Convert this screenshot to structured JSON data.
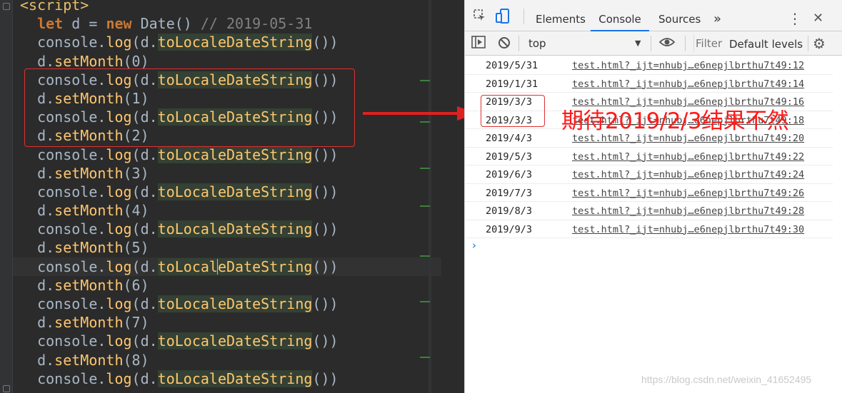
{
  "editor": {
    "lines": [
      [
        {
          "t": "<script>",
          "c": "tag"
        }
      ],
      [
        {
          "t": "  "
        },
        {
          "t": "let",
          "c": "kw"
        },
        {
          "t": " d = "
        },
        {
          "t": "new",
          "c": "kw"
        },
        {
          "t": " Date() "
        },
        {
          "t": "// 2019-05-31",
          "c": "cmt"
        }
      ],
      [
        {
          "t": "  console."
        },
        {
          "t": "log",
          "c": "fn"
        },
        {
          "t": "(d."
        },
        {
          "t": "toLocaleDateString",
          "c": "fn hl"
        },
        {
          "t": "())"
        }
      ],
      [
        {
          "t": "  d."
        },
        {
          "t": "setMonth",
          "c": "fn"
        },
        {
          "t": "(0)"
        }
      ],
      [
        {
          "t": "  console."
        },
        {
          "t": "log",
          "c": "fn"
        },
        {
          "t": "(d."
        },
        {
          "t": "toLocaleDateString",
          "c": "fn hl"
        },
        {
          "t": "())"
        }
      ],
      [
        {
          "t": "  d."
        },
        {
          "t": "setMonth",
          "c": "fn"
        },
        {
          "t": "(1)"
        }
      ],
      [
        {
          "t": "  console."
        },
        {
          "t": "log",
          "c": "fn"
        },
        {
          "t": "(d."
        },
        {
          "t": "toLocaleDateString",
          "c": "fn hl"
        },
        {
          "t": "())"
        }
      ],
      [
        {
          "t": "  d."
        },
        {
          "t": "setMonth",
          "c": "fn"
        },
        {
          "t": "(2)"
        }
      ],
      [
        {
          "t": "  console."
        },
        {
          "t": "log",
          "c": "fn"
        },
        {
          "t": "(d."
        },
        {
          "t": "toLocaleDateString",
          "c": "fn hl"
        },
        {
          "t": "())"
        }
      ],
      [
        {
          "t": "  d."
        },
        {
          "t": "setMonth",
          "c": "fn"
        },
        {
          "t": "(3)"
        }
      ],
      [
        {
          "t": "  console."
        },
        {
          "t": "log",
          "c": "fn"
        },
        {
          "t": "(d."
        },
        {
          "t": "toLocaleDateString",
          "c": "fn hl"
        },
        {
          "t": "())"
        }
      ],
      [
        {
          "t": "  d."
        },
        {
          "t": "setMonth",
          "c": "fn"
        },
        {
          "t": "(4)"
        }
      ],
      [
        {
          "t": "  console."
        },
        {
          "t": "log",
          "c": "fn"
        },
        {
          "t": "(d."
        },
        {
          "t": "toLocaleDateString",
          "c": "fn hl"
        },
        {
          "t": "())"
        }
      ],
      [
        {
          "t": "  d."
        },
        {
          "t": "setMonth",
          "c": "fn"
        },
        {
          "t": "(5)"
        }
      ],
      [
        {
          "t": "  console."
        },
        {
          "t": "log",
          "c": "fn"
        },
        {
          "t": "(d."
        },
        {
          "t": "toLocal",
          "c": "fn hl"
        },
        {
          "caret": true
        },
        {
          "t": "eDateString",
          "c": "fn hl"
        },
        {
          "t": "())"
        }
      ],
      [
        {
          "t": "  d."
        },
        {
          "t": "setMonth",
          "c": "fn"
        },
        {
          "t": "(6)"
        }
      ],
      [
        {
          "t": "  console."
        },
        {
          "t": "log",
          "c": "fn"
        },
        {
          "t": "(d."
        },
        {
          "t": "toLocaleDateString",
          "c": "fn hl"
        },
        {
          "t": "())"
        }
      ],
      [
        {
          "t": "  d."
        },
        {
          "t": "setMonth",
          "c": "fn"
        },
        {
          "t": "(7)"
        }
      ],
      [
        {
          "t": "  console."
        },
        {
          "t": "log",
          "c": "fn"
        },
        {
          "t": "(d."
        },
        {
          "t": "toLocaleDateString",
          "c": "fn hl"
        },
        {
          "t": "())"
        }
      ],
      [
        {
          "t": "  d."
        },
        {
          "t": "setMonth",
          "c": "fn"
        },
        {
          "t": "(8)"
        }
      ],
      [
        {
          "t": "  console."
        },
        {
          "t": "log",
          "c": "fn"
        },
        {
          "t": "(d."
        },
        {
          "t": "toLocaleDateString",
          "c": "fn hl"
        },
        {
          "t": "())"
        }
      ]
    ],
    "current_line": 14
  },
  "devtools": {
    "tabs": [
      "Elements",
      "Console",
      "Sources"
    ],
    "active_tab": "Console",
    "more_tabs": "»",
    "menu_icon": "⋮",
    "close_icon": "✕",
    "context": "top",
    "filter_placeholder": "Filter",
    "levels": "Default levels",
    "prompt": "›",
    "messages": [
      {
        "msg": "2019/5/31",
        "src": "test.html?_ijt=nhubj…e6nepjlbrthu7t49:12"
      },
      {
        "msg": "2019/1/31",
        "src": "test.html?_ijt=nhubj…e6nepjlbrthu7t49:14"
      },
      {
        "msg": "2019/3/3",
        "src": "test.html?_ijt=nhubj…e6nepjlbrthu7t49:16"
      },
      {
        "msg": "2019/3/3",
        "src": "test.html?_ijt=nhubj…e6nepjlbrthu7t49:18"
      },
      {
        "msg": "2019/4/3",
        "src": "test.html?_ijt=nhubj…e6nepjlbrthu7t49:20"
      },
      {
        "msg": "2019/5/3",
        "src": "test.html?_ijt=nhubj…e6nepjlbrthu7t49:22"
      },
      {
        "msg": "2019/6/3",
        "src": "test.html?_ijt=nhubj…e6nepjlbrthu7t49:24"
      },
      {
        "msg": "2019/7/3",
        "src": "test.html?_ijt=nhubj…e6nepjlbrthu7t49:26"
      },
      {
        "msg": "2019/8/3",
        "src": "test.html?_ijt=nhubj…e6nepjlbrthu7t49:28"
      },
      {
        "msg": "2019/9/3",
        "src": "test.html?_ijt=nhubj…e6nepjlbrthu7t49:30"
      }
    ]
  },
  "annotation": {
    "text": "期待2019/2/3结果不然",
    "color": "#ff1a1a"
  },
  "watermark": "https://blog.csdn.net/weixin_41652495",
  "colors": {
    "accent": "#1a73e8",
    "highlight_box": "#e03030"
  }
}
